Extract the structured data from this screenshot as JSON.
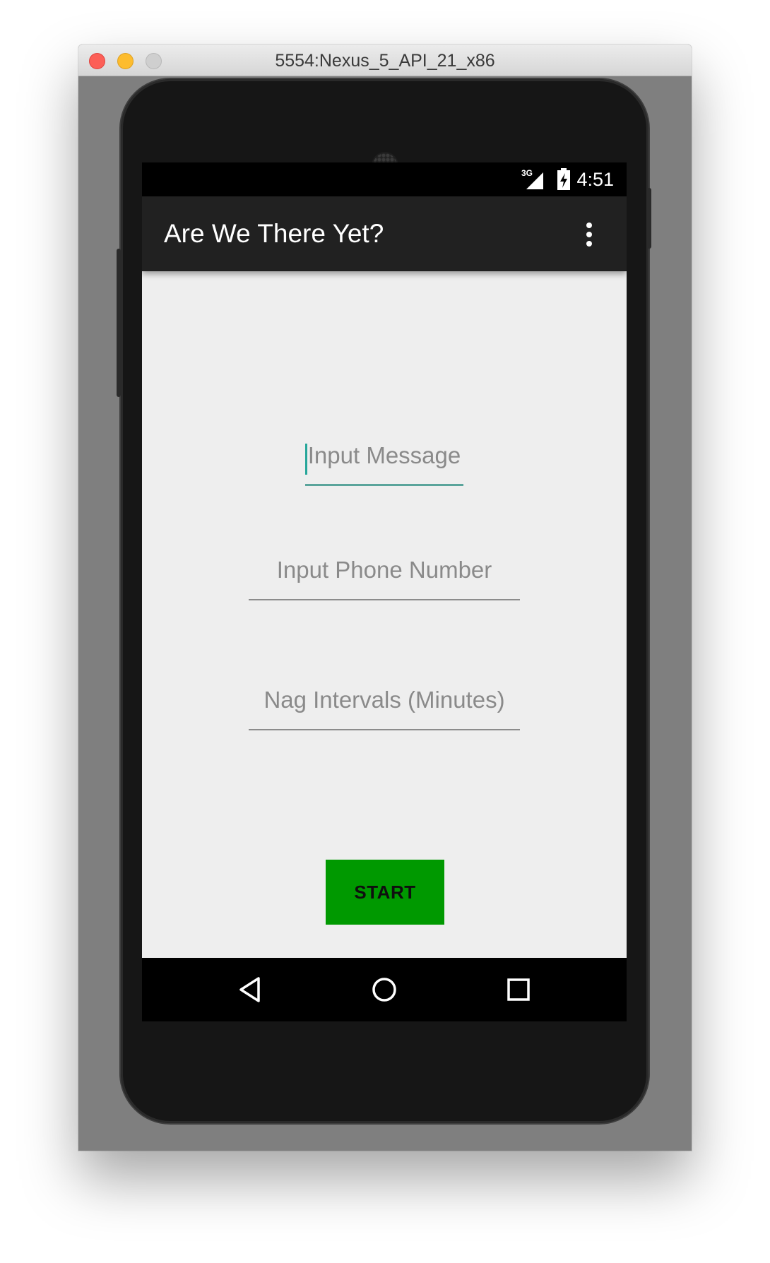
{
  "window": {
    "title": "5554:Nexus_5_API_21_x86"
  },
  "status_bar": {
    "network_type": "3G",
    "time": "4:51"
  },
  "app_bar": {
    "title": "Are We There Yet?",
    "overflow_icon": "more-vert-icon"
  },
  "form": {
    "message_placeholder": "Input Message",
    "phone_placeholder": "Input Phone Number",
    "interval_placeholder": "Nag Intervals (Minutes)",
    "start_label": "START"
  },
  "nav_bar": {
    "back_icon": "back-triangle-icon",
    "home_icon": "home-circle-icon",
    "recents_icon": "recents-square-icon"
  },
  "colors": {
    "app_bar": "#212121",
    "screen_background": "#eeeeee",
    "accent": "#26a69a",
    "start_button": "#009900",
    "emulator_frame": "#7f7f7f"
  }
}
